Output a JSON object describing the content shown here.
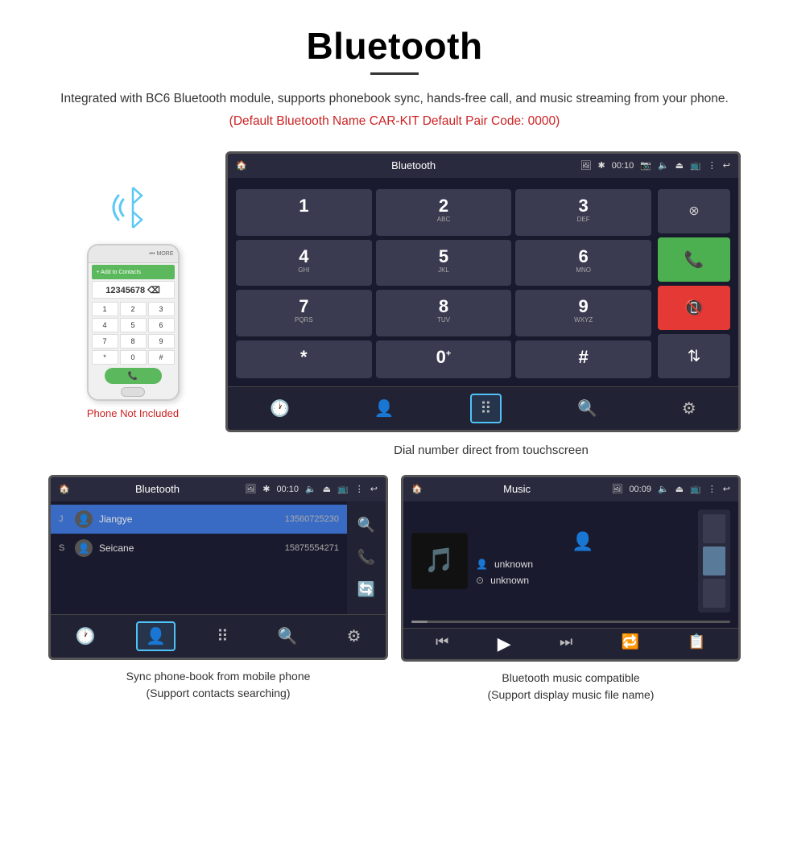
{
  "title": "Bluetooth",
  "description": "Integrated with BC6 Bluetooth module, supports phonebook sync, hands-free call, and music streaming from your phone.",
  "red_note": "(Default Bluetooth Name CAR-KIT    Default Pair Code: 0000)",
  "phone_label": "Phone Not Included",
  "dial_caption": "Dial number direct from touchscreen",
  "contacts_caption_line1": "Sync phone-book from mobile phone",
  "contacts_caption_line2": "(Support contacts searching)",
  "music_caption_line1": "Bluetooth music compatible",
  "music_caption_line2": "(Support display music file name)",
  "car_screen1": {
    "title": "Bluetooth",
    "time": "00:10",
    "dialpad": {
      "keys": [
        {
          "num": "1",
          "letters": ""
        },
        {
          "num": "2",
          "letters": "ABC"
        },
        {
          "num": "3",
          "letters": "DEF"
        },
        {
          "num": "4",
          "letters": "GHI"
        },
        {
          "num": "5",
          "letters": "JKL"
        },
        {
          "num": "6",
          "letters": "MNO"
        },
        {
          "num": "7",
          "letters": "PQRS"
        },
        {
          "num": "8",
          "letters": "TUV"
        },
        {
          "num": "9",
          "letters": "WXYZ"
        },
        {
          "num": "*",
          "letters": ""
        },
        {
          "num": "0",
          "letters": "+"
        },
        {
          "num": "#",
          "letters": ""
        }
      ]
    }
  },
  "car_screen2": {
    "title": "Bluetooth",
    "time": "00:10",
    "contacts": [
      {
        "letter": "J",
        "name": "Jiangye",
        "number": "13560725230",
        "selected": true
      },
      {
        "letter": "S",
        "name": "Seicane",
        "number": "15875554271",
        "selected": false
      }
    ]
  },
  "car_screen3": {
    "title": "Music",
    "time": "00:09",
    "track_info": [
      {
        "label": "unknown"
      },
      {
        "label": "unknown"
      }
    ]
  }
}
